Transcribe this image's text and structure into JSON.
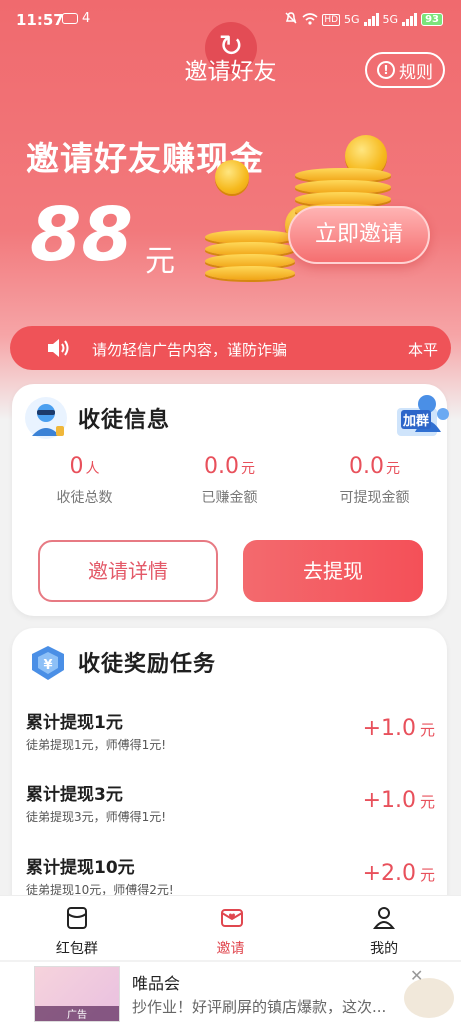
{
  "status_bar": {
    "time": "11:57",
    "notification_count": "4",
    "battery": "93",
    "net_labels": [
      "HD",
      "5G",
      "5G"
    ]
  },
  "header": {
    "title": "邀请好友",
    "rules_label": "规则"
  },
  "hero": {
    "headline": "邀请好友赚现金",
    "amount": "88",
    "unit": "元",
    "invite_now_label": "立即邀请"
  },
  "notice": {
    "text": "请勿轻信广告内容，谨防诈骗",
    "text_continued": "本平"
  },
  "apprentice_card": {
    "title": "收徒信息",
    "group_badge": "加群",
    "stats": [
      {
        "value": "0",
        "unit": "人",
        "label": "收徒总数"
      },
      {
        "value": "0.0",
        "unit": "元",
        "label": "已赚金额"
      },
      {
        "value": "0.0",
        "unit": "元",
        "label": "可提现金额"
      }
    ],
    "invite_details_label": "邀请详情",
    "withdraw_label": "去提现"
  },
  "tasks_card": {
    "title": "收徒奖励任务",
    "tasks": [
      {
        "title": "累计提现1元",
        "desc": "徒弟提现1元，师傅得1元!",
        "reward": "+1.0",
        "unit": "元"
      },
      {
        "title": "累计提现3元",
        "desc": "徒弟提现3元，师傅得1元!",
        "reward": "+1.0",
        "unit": "元"
      },
      {
        "title": "累计提现10元",
        "desc": "徒弟提现10元，师傅得2元!",
        "reward": "+2.0",
        "unit": "元"
      }
    ]
  },
  "bottom_nav": {
    "items": [
      {
        "label": "红包群",
        "icon": "red-packet-icon"
      },
      {
        "label": "邀请",
        "icon": "invite-icon",
        "active": true
      },
      {
        "label": "我的",
        "icon": "profile-icon"
      }
    ]
  },
  "ad": {
    "thumb_label": "广告",
    "brand": "唯品会",
    "text": "抄作业！好评刷屏的镇店爆款，这次..."
  },
  "colors": {
    "accent": "#e8505b",
    "hero_top": "#f06a6e",
    "notice_bg": "#ef5358"
  }
}
